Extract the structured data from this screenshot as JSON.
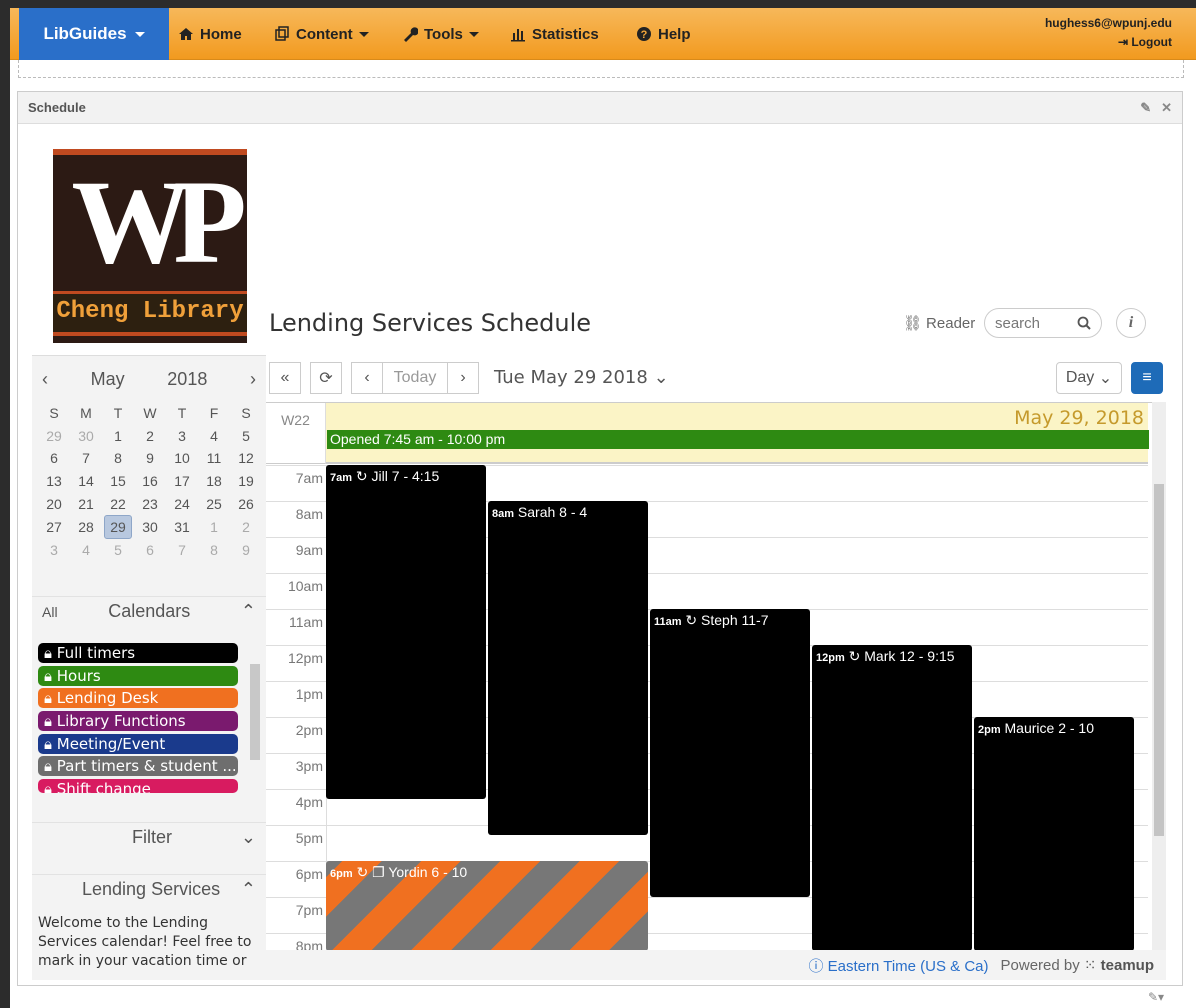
{
  "topbar": {
    "brand": "LibGuides",
    "nav": [
      {
        "label": "Home",
        "icon": "home-icon"
      },
      {
        "label": "Content",
        "icon": "content-icon",
        "caret": true
      },
      {
        "label": "Tools",
        "icon": "wrench-icon",
        "caret": true
      },
      {
        "label": "Statistics",
        "icon": "bar-chart-icon"
      },
      {
        "label": "Help",
        "icon": "question-icon"
      }
    ],
    "user_email": "hughess6@wpunj.edu",
    "logout": "Logout"
  },
  "panel": {
    "title": "Schedule"
  },
  "logo": {
    "monogram": "WP",
    "text": "Cheng Library"
  },
  "calendar": {
    "title": "Lending Services Schedule",
    "reader": "Reader",
    "search_placeholder": "search",
    "info": "i",
    "date_label": "Tue May 29 2018",
    "today": "Today",
    "view": "Day",
    "week": "W22",
    "day_header": "May 29, 2018",
    "allday_event": "Opened 7:45 am - 10:00 pm",
    "hours": [
      "7am",
      "8am",
      "9am",
      "10am",
      "11am",
      "12pm",
      "1pm",
      "2pm",
      "3pm",
      "4pm",
      "5pm",
      "6pm",
      "7pm",
      "8pm"
    ],
    "events": [
      {
        "time": "7am",
        "label": "Jill 7 - 4:15",
        "recurring": true
      },
      {
        "time": "8am",
        "label": "Sarah 8 - 4",
        "recurring": false
      },
      {
        "time": "11am",
        "label": "Steph 11-7",
        "recurring": true
      },
      {
        "time": "12pm",
        "label": "Mark 12 - 9:15",
        "recurring": true
      },
      {
        "time": "2pm",
        "label": "Maurice 2 - 10",
        "recurring": false
      },
      {
        "time": "6pm",
        "label": "Yordin 6 - 10",
        "recurring": true
      }
    ],
    "timezone": "Eastern Time (US & Ca)",
    "powered_by": "Powered by",
    "vendor": "teamup"
  },
  "mini_calendar": {
    "month": "May",
    "year": "2018",
    "weekdays": [
      "S",
      "M",
      "T",
      "W",
      "T",
      "F",
      "S"
    ],
    "weeks": [
      [
        "29",
        "30",
        "1",
        "2",
        "3",
        "4",
        "5"
      ],
      [
        "6",
        "7",
        "8",
        "9",
        "10",
        "11",
        "12"
      ],
      [
        "13",
        "14",
        "15",
        "16",
        "17",
        "18",
        "19"
      ],
      [
        "20",
        "21",
        "22",
        "23",
        "24",
        "25",
        "26"
      ],
      [
        "27",
        "28",
        "29",
        "30",
        "31",
        "1",
        "2"
      ],
      [
        "3",
        "4",
        "5",
        "6",
        "7",
        "8",
        "9"
      ]
    ],
    "selected": "29"
  },
  "calendars_section": {
    "all": "All",
    "title": "Calendars",
    "items": [
      {
        "label": "Full timers",
        "color": "#000000"
      },
      {
        "label": "Hours",
        "color": "#2e8a12"
      },
      {
        "label": "Lending Desk",
        "color": "#f07020"
      },
      {
        "label": "Library Functions",
        "color": "#7a1a6e"
      },
      {
        "label": "Meeting/Event",
        "color": "#1a3a8c"
      },
      {
        "label": "Part timers & student ...",
        "color": "#6e6e6e"
      },
      {
        "label": "Shift change",
        "color": "#d81b60"
      }
    ]
  },
  "filter": {
    "title": "Filter"
  },
  "lending_section": {
    "title": "Lending Services",
    "text": "Welcome to the Lending Services calendar! Feel free to mark in your vacation time or"
  }
}
